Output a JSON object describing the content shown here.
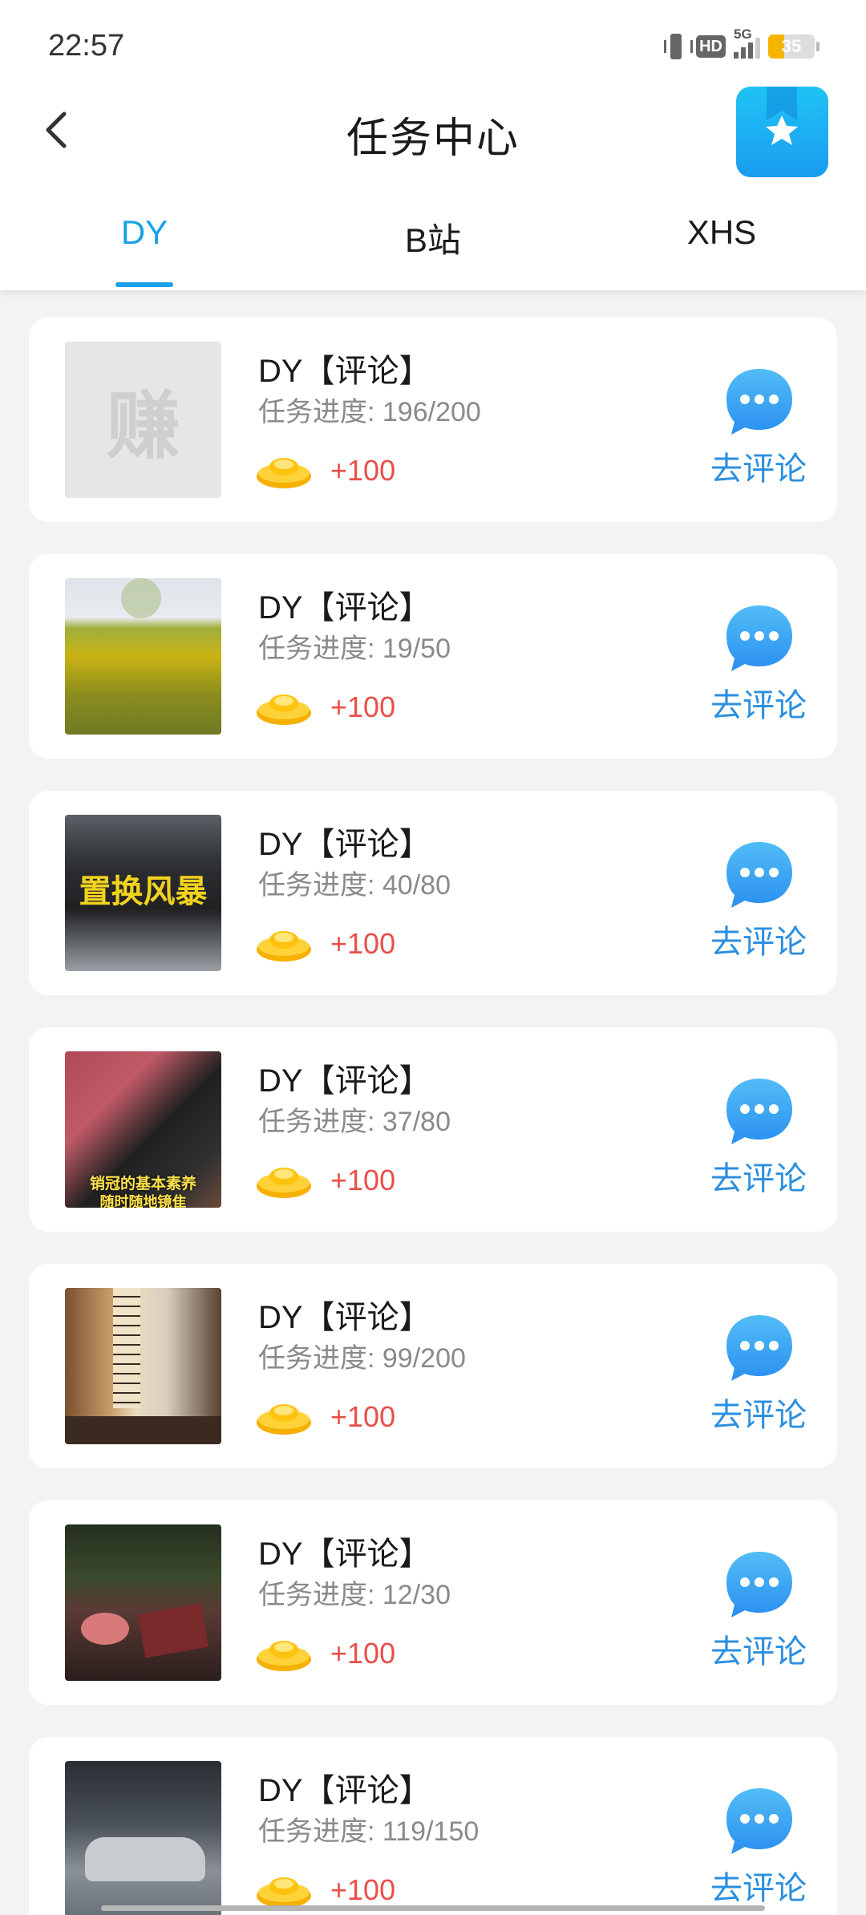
{
  "status_bar": {
    "time": "22:57",
    "hd": "HD",
    "network": "5G",
    "battery": "35",
    "battery_level": 0.35
  },
  "nav": {
    "title": "任务中心",
    "back_icon": "chevron-left-icon",
    "favorite_icon": "star-bookmark-icon"
  },
  "tabs": [
    {
      "label": "DY",
      "active": true
    },
    {
      "label": "B站",
      "active": false
    },
    {
      "label": "XHS",
      "active": false
    }
  ],
  "colors": {
    "accent": "#1aa0e8",
    "reward": "#e8504a",
    "action": "#2b8fe0"
  },
  "tasks": [
    {
      "title": "DY【评论】",
      "progress": "任务进度: 196/200",
      "reward": "+100",
      "action": "去评论",
      "thumb": "placeholder",
      "thumb_text": "赚"
    },
    {
      "title": "DY【评论】",
      "progress": "任务进度: 19/50",
      "reward": "+100",
      "action": "去评论",
      "thumb": "flower-field"
    },
    {
      "title": "DY【评论】",
      "progress": "任务进度: 40/80",
      "reward": "+100",
      "action": "去评论",
      "thumb": "car-interior",
      "thumb_text": "置换风暴"
    },
    {
      "title": "DY【评论】",
      "progress": "任务进度: 37/80",
      "reward": "+100",
      "action": "去评论",
      "thumb": "sales-video",
      "thumb_text": "销冠的基本素养",
      "thumb_text2": "随时随地镜隹"
    },
    {
      "title": "DY【评论】",
      "progress": "任务进度: 99/200",
      "reward": "+100",
      "action": "去评论",
      "thumb": "tea-scroll"
    },
    {
      "title": "DY【评论】",
      "progress": "任务进度: 12/30",
      "reward": "+100",
      "action": "去评论",
      "thumb": "hotpot-table"
    },
    {
      "title": "DY【评论】",
      "progress": "任务进度: 119/150",
      "reward": "+100",
      "action": "去评论",
      "thumb": "car-showroom"
    }
  ]
}
